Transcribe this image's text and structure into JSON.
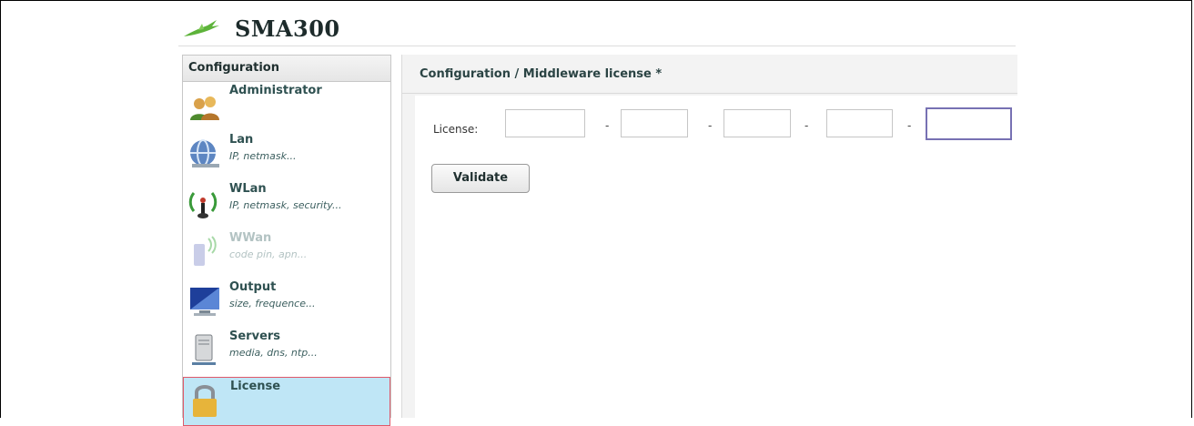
{
  "app": {
    "title": "SMA300",
    "accent": "#5db33a"
  },
  "sidebar": {
    "header": "Configuration",
    "items": [
      {
        "label": "Administrator",
        "sub": "",
        "icon": "users-icon",
        "state": "normal"
      },
      {
        "label": "Lan",
        "sub": "IP, netmask...",
        "icon": "network-globe-icon",
        "state": "normal"
      },
      {
        "label": "WLan",
        "sub": "IP, netmask, security...",
        "icon": "wireless-antenna-icon",
        "state": "normal"
      },
      {
        "label": "WWan",
        "sub": "code pin, apn...",
        "icon": "mobile-signal-icon",
        "state": "disabled"
      },
      {
        "label": "Output",
        "sub": "size, frequence...",
        "icon": "monitor-icon",
        "state": "normal"
      },
      {
        "label": "Servers",
        "sub": "media, dns, ntp...",
        "icon": "server-tower-icon",
        "state": "normal"
      },
      {
        "label": "License",
        "sub": "",
        "icon": "padlock-icon",
        "state": "active"
      }
    ]
  },
  "main": {
    "title": "Configuration / Middleware license *",
    "license_label": "License:",
    "separator": "-",
    "license_values": [
      "",
      "",
      "",
      "",
      ""
    ],
    "validate_label": "Validate"
  }
}
